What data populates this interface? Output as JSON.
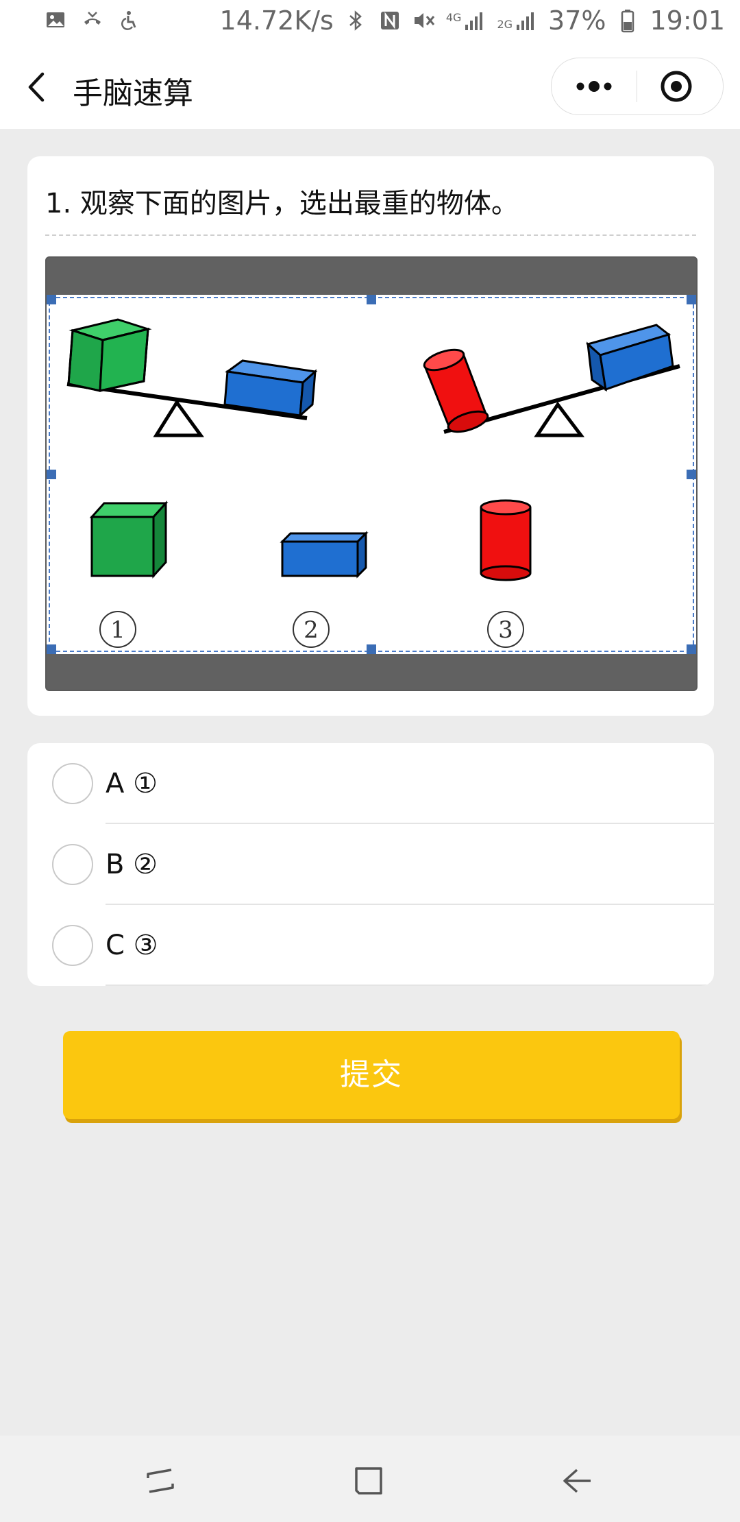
{
  "status_bar": {
    "speed": "14.72K/s",
    "net_4g": "4G",
    "net_2g": "2G",
    "battery": "37%",
    "time": "19:01",
    "icons": [
      "image-icon",
      "missed-call-icon",
      "accessibility-icon",
      "bluetooth-icon",
      "nfc-icon",
      "mute-icon",
      "signal-icon",
      "battery-icon"
    ]
  },
  "nav": {
    "title": "手脑速算",
    "back_icon": "chevron-left-icon",
    "more_icon": "more-dots-icon",
    "close_icon": "target-icon"
  },
  "question": {
    "text": "1. 观察下面的图片，选出最重的物体。",
    "figure": {
      "labels": [
        "①",
        "②",
        "③"
      ]
    }
  },
  "options": [
    {
      "letter": "A",
      "value": "①"
    },
    {
      "letter": "B",
      "value": "②"
    },
    {
      "letter": "C",
      "value": "③"
    }
  ],
  "submit": {
    "label": "提交"
  },
  "colors": {
    "accent": "#fbc70f",
    "cube_green": "#1fa64a",
    "box_blue": "#1f6fd1",
    "cylinder_red": "#f01010"
  },
  "bottom_nav": {
    "icons": [
      "recent-apps-icon",
      "home-icon",
      "back-icon"
    ]
  }
}
